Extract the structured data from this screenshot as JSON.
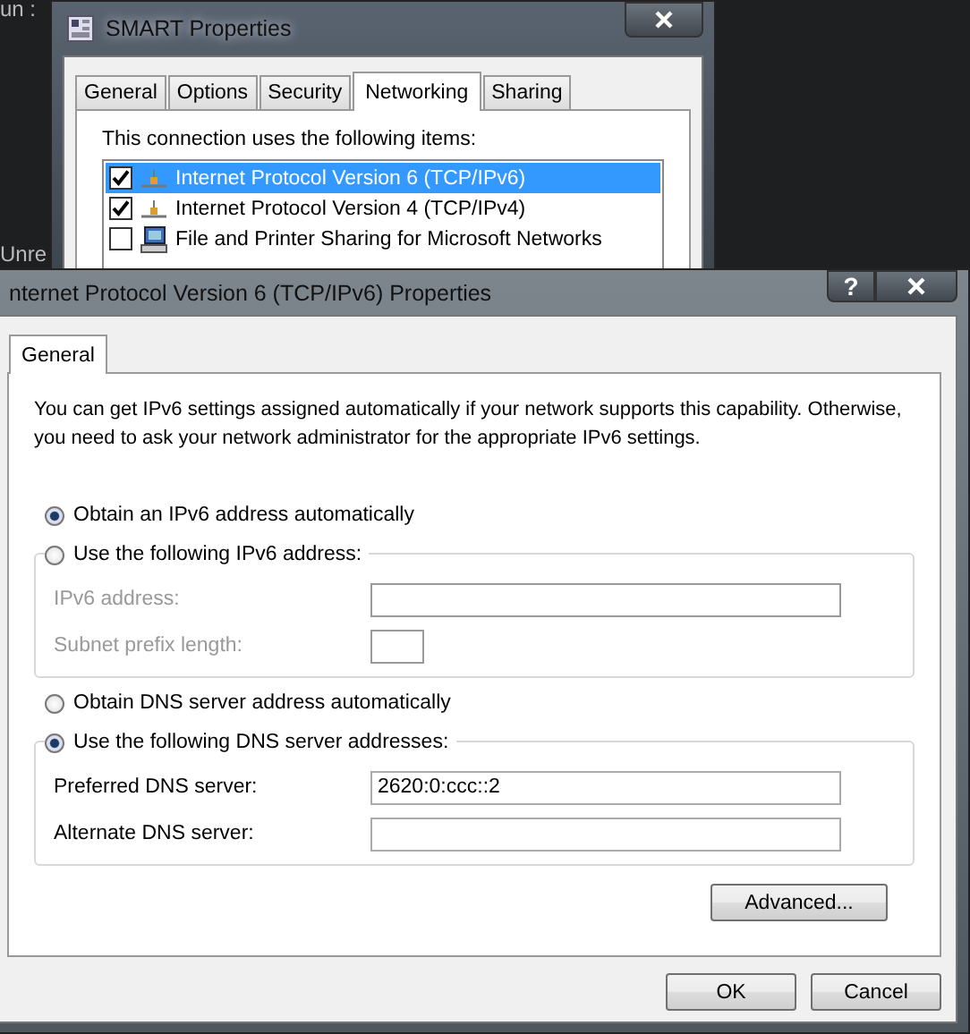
{
  "terminal": {
    "lines": [
      "un :",
      "Unre"
    ]
  },
  "back_window": {
    "title": "SMART Properties",
    "tabs": [
      {
        "label": "General",
        "selected": false
      },
      {
        "label": "Options",
        "selected": false
      },
      {
        "label": "Security",
        "selected": false
      },
      {
        "label": "Networking",
        "selected": true
      },
      {
        "label": "Sharing",
        "selected": false
      }
    ],
    "caption": "This connection uses the following items:",
    "items": [
      {
        "label": "Internet Protocol Version 6 (TCP/IPv6)",
        "checked": true,
        "selected": true,
        "kind": "protocol"
      },
      {
        "label": "Internet Protocol Version 4 (TCP/IPv4)",
        "checked": true,
        "selected": false,
        "kind": "protocol"
      },
      {
        "label": "File and Printer Sharing for Microsoft Networks",
        "checked": false,
        "selected": false,
        "kind": "service"
      }
    ]
  },
  "dialog": {
    "title": "nternet Protocol Version 6 (TCP/IPv6) Properties",
    "help_button": "?",
    "tabs": [
      {
        "label": "General",
        "selected": true
      }
    ],
    "description": "You can get IPv6 settings assigned automatically if your network supports this capability. Otherwise, you need to ask your network administrator for the appropriate IPv6 settings.",
    "sections": [
      {
        "options": [
          {
            "label": "Obtain an IPv6 address automatically",
            "selected": true
          },
          {
            "label": "Use the following IPv6 address:",
            "selected": false
          }
        ],
        "fields": [
          {
            "label": "IPv6 address:",
            "disabled": true,
            "kind": "wide"
          },
          {
            "label": "Subnet prefix length:",
            "disabled": true,
            "kind": "short"
          }
        ]
      },
      {
        "options": [
          {
            "label": "Obtain DNS server address automatically",
            "selected": false
          },
          {
            "label": "Use the following DNS server addresses:",
            "selected": true
          }
        ],
        "fields": [
          {
            "label": "Preferred DNS server:",
            "disabled": false,
            "kind": "wide",
            "value": "2620:0:ccc::2"
          },
          {
            "label": "Alternate DNS server:",
            "disabled": false,
            "kind": "wide"
          }
        ]
      }
    ],
    "advanced_button": "Advanced...",
    "buttons": [
      "OK",
      "Cancel"
    ]
  }
}
